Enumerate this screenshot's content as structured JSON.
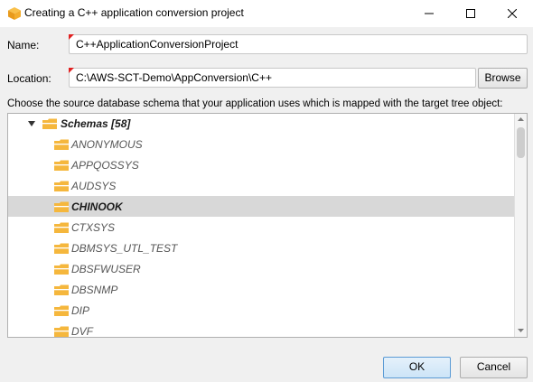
{
  "window": {
    "title": "Creating a C++ application conversion project",
    "icon": "cube-icon",
    "controls": [
      "minimize-icon",
      "maximize-icon",
      "close-icon"
    ]
  },
  "form": {
    "name_label": "Name:",
    "name_value": "C++ApplicationConversionProject",
    "location_label": "Location:",
    "location_value": "C:\\AWS-SCT-Demo\\AppConversion\\C++",
    "browse_label": "Browse"
  },
  "instruction": "Choose the source database schema that your application uses which is mapped with the target tree object:",
  "tree": {
    "root": {
      "label": "Schemas [58]",
      "expanded": true
    },
    "items": [
      {
        "label": "ANONYMOUS",
        "selected": false
      },
      {
        "label": "APPQOSSYS",
        "selected": false
      },
      {
        "label": "AUDSYS",
        "selected": false
      },
      {
        "label": "CHINOOK",
        "selected": true
      },
      {
        "label": "CTXSYS",
        "selected": false
      },
      {
        "label": "DBMSYS_UTL_TEST",
        "selected": false
      },
      {
        "label": "DBSFWUSER",
        "selected": false
      },
      {
        "label": "DBSNMP",
        "selected": false
      },
      {
        "label": "DIP",
        "selected": false
      },
      {
        "label": "DVF",
        "selected": false
      }
    ]
  },
  "buttons": {
    "ok_label": "OK",
    "cancel_label": "Cancel"
  },
  "colors": {
    "folder": "#f5b73d",
    "required_marker": "#e02020",
    "selection": "#d8d8d8",
    "primary_border": "#5b9bd5"
  }
}
